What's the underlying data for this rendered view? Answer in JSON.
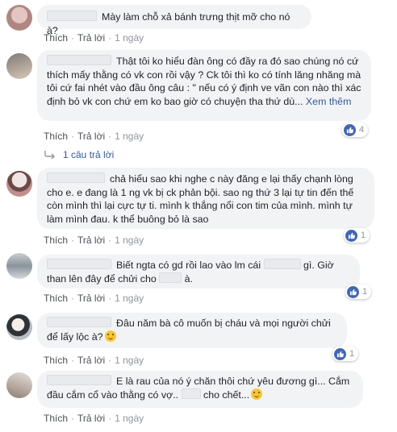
{
  "labels": {
    "like": "Thích",
    "reply": "Trả lời",
    "dot": "·"
  },
  "comments": [
    {
      "text": "Mày làm chỗ xả bánh trưng thịt mỡ cho nó à?",
      "time": "1 ngày"
    },
    {
      "text": "Thật tôi ko hiểu đàn ông có đầy ra đó sao chúng nó cứ thích mấy thằng có vk con rồi vậy ? Ck tôi thì ko có tính lăng nhăng mà tôi cứ fai nhét vào đầu ông câu : \" nếu có ý định ve vãn con nào thì xác định bỏ vk con chứ em ko bao giờ có chuyện tha thứ dù...",
      "see_more": "Xem thêm",
      "time": "1 ngày",
      "reactions": "4",
      "replies_label": "1 câu trả lời"
    },
    {
      "text": "chả hiểu sao khi nghe c này đăng e lại thấy chạnh lòng cho e. e đang là 1 ng vk bị ck phản bội. sao ng thứ 3 lại tự tin đến thế còn mình thì lại cực tự ti. mình k thắng nổi con tim của mình. mình tự làm mình đau. k thể buông bỏ là sao",
      "time": "1 ngày",
      "reactions": "1"
    },
    {
      "text_a": "Biết ngta có gd rồi lao vào lm cái",
      "text_b": "gì. Giờ than lên đây để chửi cho",
      "text_c": "à.",
      "time": "1 ngày",
      "reactions": "1"
    },
    {
      "text": "Đâu năm bà cô muốn bị cháu và mọi người chửi để lấy lộc à?",
      "time": "1 ngày",
      "reactions": "1"
    },
    {
      "text_a": "E là rau của nó ý chăn thôi chứ yêu đương gì... Cắm đầu cắm cổ vào thằng có vợ..",
      "text_b": "cho chết...",
      "time": "1 ngày"
    }
  ],
  "colors": {
    "bubble": "#f2f3f5",
    "link": "#385898",
    "like_badge": "#4267b2"
  }
}
